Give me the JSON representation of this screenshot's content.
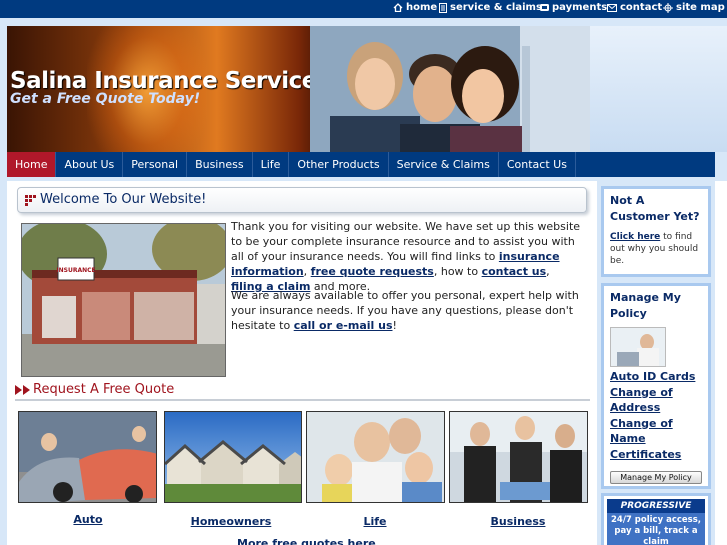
{
  "topbar": {
    "links": [
      {
        "label": "home",
        "icon": "home-icon"
      },
      {
        "label": "service & claims",
        "icon": "document-icon"
      },
      {
        "label": "payments",
        "icon": "payment-icon"
      },
      {
        "label": "contact",
        "icon": "envelope-icon"
      },
      {
        "label": "site map",
        "icon": "sitemap-icon"
      }
    ]
  },
  "header": {
    "title": "Salina Insurance Services",
    "tagline": "Get a Free Quote Today!"
  },
  "nav": {
    "items": [
      "Home",
      "About Us",
      "Personal",
      "Business",
      "Life",
      "Other Products",
      "Service & Claims",
      "Contact Us"
    ],
    "active": "Home"
  },
  "welcome": {
    "title": "Welcome To Our Website!",
    "para1_a": "Thank you for visiting our website. We have set up this website to be your complete insurance resource and to assist you with all of your insurance needs. You will find links to ",
    "link_info": "insurance information",
    "comma1": ", ",
    "link_free": "free quote requests",
    "para1_b": ", how to ",
    "link_contact": "contact us",
    "comma2": ", ",
    "link_claim": "filing a claim",
    "para1_c": " and more.",
    "para2_a": "We are always available to offer you personal, expert help with your insurance needs. If you have any questions, please don't hesitate to ",
    "link_call": "call or e-mail us",
    "para2_b": "!",
    "office_sign": "INSURANCE"
  },
  "quotes": {
    "heading": "Request A Free Quote",
    "items": [
      "Auto",
      "Homeowners",
      "Life",
      "Business"
    ],
    "more": "More free quotes here"
  },
  "sidebar": {
    "not_customer": {
      "title": "Not A Customer Yet?",
      "link": "Click here",
      "text": " to find out why you should be."
    },
    "manage": {
      "title": "Manage My Policy",
      "links": [
        "Auto ID Cards",
        "Change of Address",
        "Change of Name Certificates"
      ],
      "button": "Manage My Policy"
    },
    "progressive": {
      "logo": "PROGRESSIVE",
      "text": "24/7 policy access, pay a bill, track a claim"
    }
  },
  "colors": {
    "navy": "#003a80",
    "active_nav": "#b0182a",
    "link": "#0a2a66",
    "heading_red": "#a0141e"
  }
}
